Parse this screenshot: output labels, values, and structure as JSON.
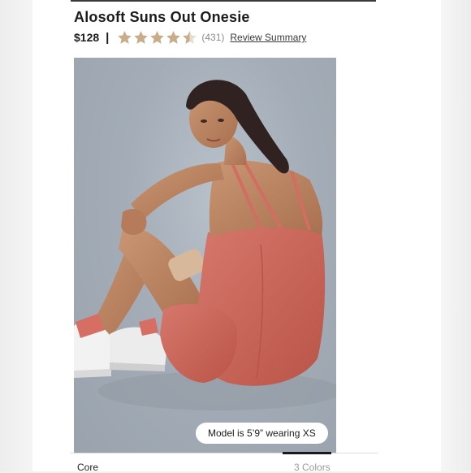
{
  "product": {
    "title": "Alosoft Suns Out Onesie",
    "price": "$128",
    "separator": "|",
    "rating": 4.5,
    "rating_max": 5,
    "review_count": "(431)",
    "review_link": "Review Summary"
  },
  "image": {
    "model_info": "Model is 5’9” wearing XS"
  },
  "options": {
    "collection": "Core",
    "colors_count": "3 Colors"
  },
  "colors": {
    "star": "#c9ad89",
    "star_empty": "#e6dccf",
    "onesie": "#cf6a5f",
    "backdrop": "#a4adb7"
  },
  "icons": {
    "star": "star-icon"
  }
}
